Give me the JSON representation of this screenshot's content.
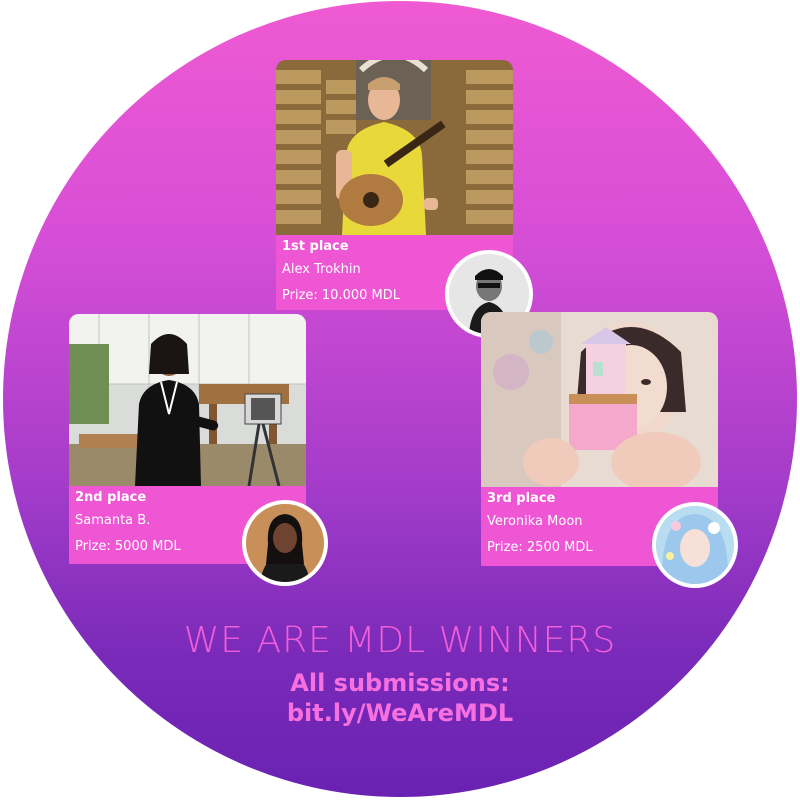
{
  "colors": {
    "gradient_top": "#ef5ad2",
    "gradient_bottom": "#6a22b2",
    "card_label_bg": "#ef56d4",
    "text_pink": "#f35fd8"
  },
  "winners": [
    {
      "place": "1st place",
      "name": "Alex Trokhin",
      "prize": "Prize: 10.000 MDL"
    },
    {
      "place": "2nd place",
      "name": "Samanta B.",
      "prize": "Prize: 5000 MDL"
    },
    {
      "place": "3rd place",
      "name": "Veronika Moon",
      "prize": "Prize: 2500 MDL"
    }
  ],
  "headline": "WE ARE MDL WINNERS",
  "submissions": {
    "label": "All submissions:",
    "link": "bit.ly/WeAreMDL"
  }
}
